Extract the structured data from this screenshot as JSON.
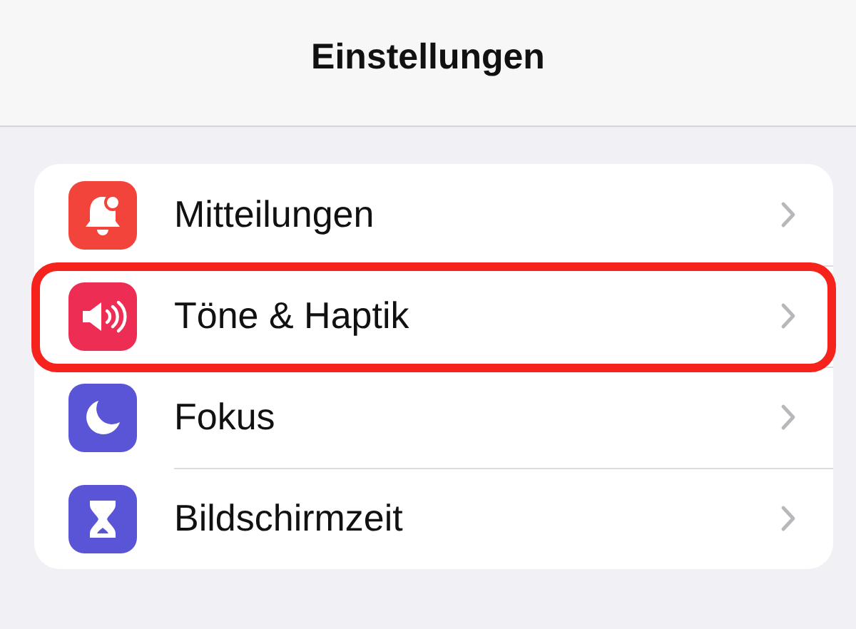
{
  "header": {
    "title": "Einstellungen"
  },
  "items": [
    {
      "label": "Mitteilungen",
      "kind": "bell",
      "color": "#f2443a",
      "highlighted": false
    },
    {
      "label": "Töne & Haptik",
      "kind": "speaker",
      "color": "#ee2d55",
      "highlighted": true
    },
    {
      "label": "Fokus",
      "kind": "moon",
      "color": "#5a55d6",
      "highlighted": false
    },
    {
      "label": "Bildschirmzeit",
      "kind": "hourglass",
      "color": "#5a55d6",
      "highlighted": false
    }
  ]
}
